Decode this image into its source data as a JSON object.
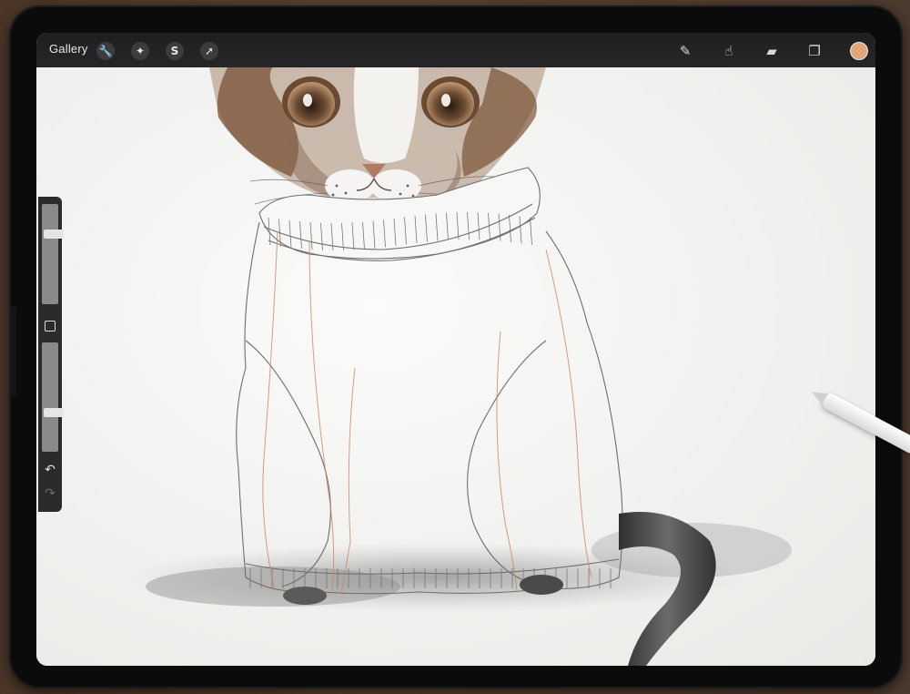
{
  "toolbar": {
    "gallery_label": "Gallery",
    "left_tools": [
      {
        "name": "actions",
        "icon": "wrench-icon",
        "glyph": "🔧"
      },
      {
        "name": "adjustments",
        "icon": "magic-wand-icon",
        "glyph": "✦"
      },
      {
        "name": "selection",
        "icon": "selection-s-icon",
        "glyph": "S"
      },
      {
        "name": "transform",
        "icon": "arrow-cursor-icon",
        "glyph": "➚"
      }
    ],
    "right_tools": [
      {
        "name": "brush",
        "icon": "brush-icon",
        "glyph": "✎"
      },
      {
        "name": "smudge",
        "icon": "smudge-icon",
        "glyph": "☝"
      },
      {
        "name": "eraser",
        "icon": "eraser-icon",
        "glyph": "▰"
      },
      {
        "name": "layers",
        "icon": "layers-icon",
        "glyph": "❐"
      }
    ],
    "current_color": "#e0a77a"
  },
  "sidebar": {
    "brush_size_level": 0.72,
    "opacity_level": 0.35,
    "undo_glyph": "↶",
    "redo_glyph": "↷"
  },
  "colors": {
    "toolbar_bg": "#232325",
    "canvas_paper": "#f1f1ef",
    "sketch_line": "#6e6e6e",
    "sketch_orange": "#c9885d",
    "fur_brown": "#8a5a3a",
    "shadow_gray": "#6d6d6d",
    "tail_dark": "#3a3a3a"
  }
}
